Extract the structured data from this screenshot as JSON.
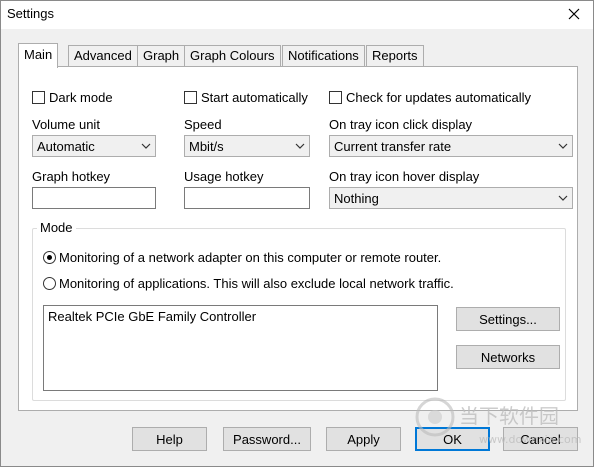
{
  "window": {
    "title": "Settings"
  },
  "tabs": [
    {
      "label": "Main",
      "active": true
    },
    {
      "label": "Advanced"
    },
    {
      "label": "Graph"
    },
    {
      "label": "Graph Colours"
    },
    {
      "label": "Notifications"
    },
    {
      "label": "Reports"
    }
  ],
  "main": {
    "dark_mode": {
      "label": "Dark mode",
      "checked": false
    },
    "start_automatically": {
      "label": "Start automatically",
      "checked": false
    },
    "check_updates": {
      "label": "Check for updates automatically",
      "checked": false
    },
    "volume_unit": {
      "label": "Volume unit",
      "value": "Automatic"
    },
    "speed": {
      "label": "Speed",
      "value": "Mbit/s"
    },
    "tray_click": {
      "label": "On tray icon click display",
      "value": "Current transfer rate"
    },
    "graph_hotkey": {
      "label": "Graph hotkey",
      "value": ""
    },
    "usage_hotkey": {
      "label": "Usage hotkey",
      "value": ""
    },
    "tray_hover": {
      "label": "On tray icon hover display",
      "value": "Nothing"
    },
    "mode": {
      "title": "Mode",
      "options": [
        {
          "label": "Monitoring of a network adapter on this computer or remote router.",
          "selected": true
        },
        {
          "label": "Monitoring of applications. This will also exclude local network traffic.",
          "selected": false
        }
      ],
      "adapters": [
        "Realtek PCIe GbE Family Controller"
      ],
      "settings_button": "Settings...",
      "networks_button": "Networks"
    }
  },
  "buttons": {
    "help": "Help",
    "password": "Password...",
    "apply": "Apply",
    "ok": "OK",
    "cancel": "Cancel"
  },
  "watermark": {
    "text": "当下软件园",
    "url": "www.downxia.com"
  },
  "colors": {
    "accent": "#0078d7",
    "dialog_bg": "#f0f0f0",
    "panel_bg": "#ffffff"
  }
}
